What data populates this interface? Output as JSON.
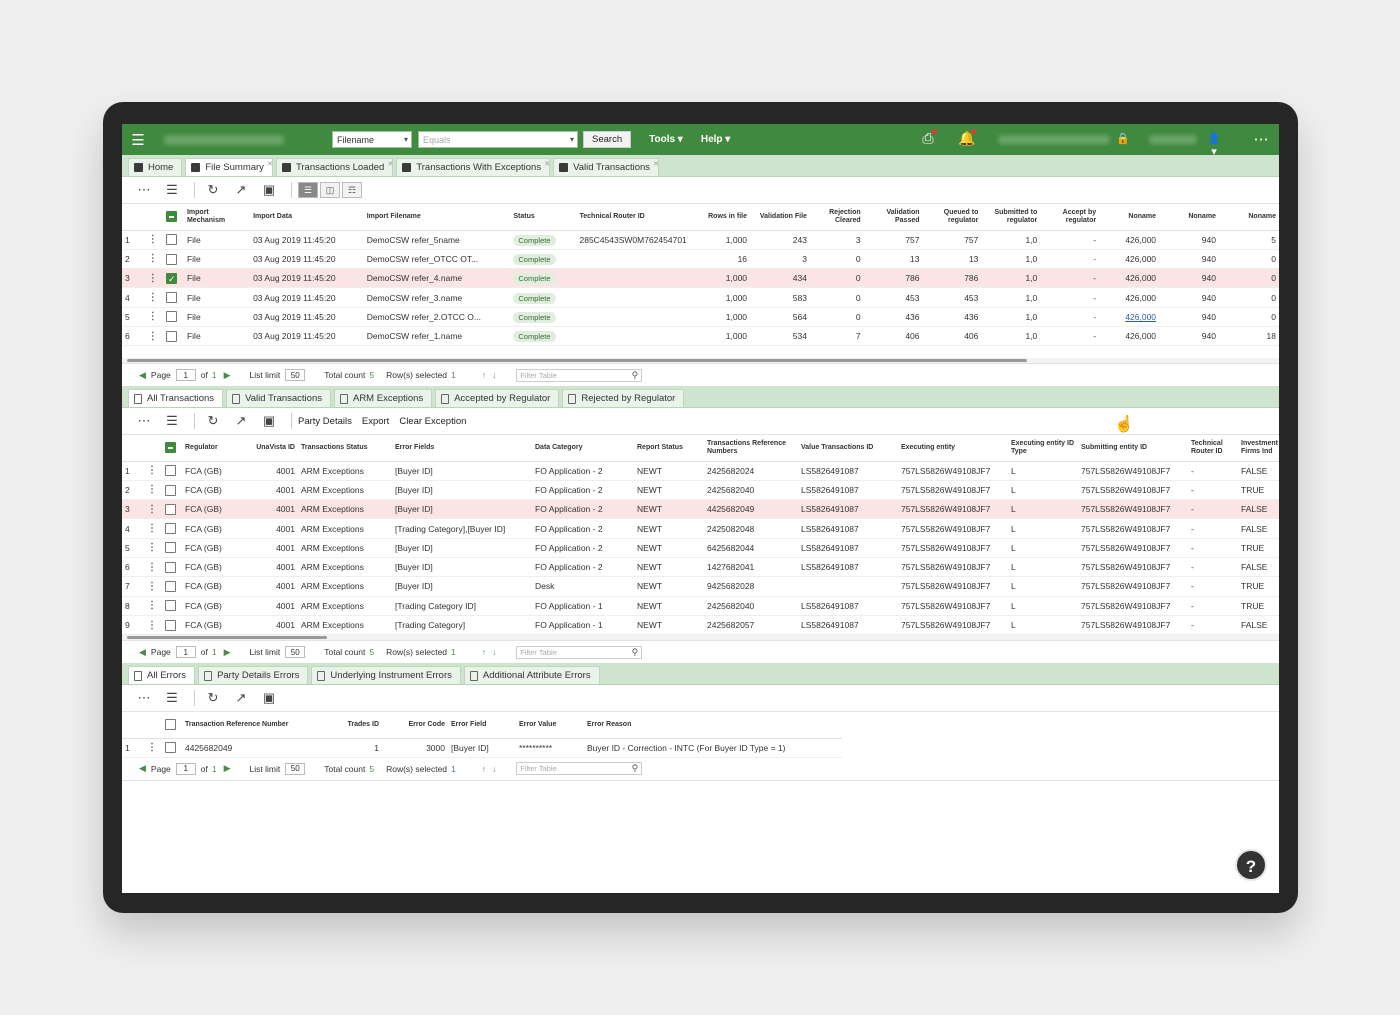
{
  "topbar": {
    "filter_field": "Filename",
    "filter_op_placeholder": "Equals",
    "search_label": "Search",
    "menus": [
      "Tools ▾",
      "Help ▾"
    ],
    "icons": [
      "hamburger-icon",
      "export-notification-icon",
      "bell-icon",
      "lock-icon",
      "user-icon",
      "apps-grid-icon"
    ]
  },
  "main_tabs": [
    {
      "label": "Home"
    },
    {
      "label": "File Summary"
    },
    {
      "label": "Transactions Loaded"
    },
    {
      "label": "Transactions With Exceptions"
    },
    {
      "label": "Valid Transactions"
    }
  ],
  "files": {
    "headers": [
      "Import Mechanism",
      "Import Data",
      "Import Filename",
      "Status",
      "Technical Router ID",
      "Rows in file",
      "Validation File",
      "Rejection Cleared",
      "Validation Passed",
      "Queued to regulator",
      "Submitted to regulator",
      "Accept by regulator",
      "Noname",
      "Noname",
      "Noname"
    ],
    "rows": [
      {
        "n": "1",
        "mech": "File",
        "date": "03 Aug 2019 11:45:20",
        "file": "DemoCSW refer_5name",
        "status": "Complete",
        "router": "285C4543SW0M762454701",
        "rows": "1,000",
        "vf": "243",
        "rc": "3",
        "vp": "757",
        "q": "757",
        "s": "1,0",
        "a": "-",
        "n1": "426,000",
        "n2": "940",
        "n3": "5"
      },
      {
        "n": "2",
        "mech": "File",
        "date": "03 Aug 2019 11:45:20",
        "file": "DemoCSW refer_OTCC OT...",
        "status": "Complete",
        "router": "",
        "rows": "16",
        "vf": "3",
        "rc": "0",
        "vp": "13",
        "q": "13",
        "s": "1,0",
        "a": "-",
        "n1": "426,000",
        "n2": "940",
        "n3": "0"
      },
      {
        "n": "3",
        "mech": "File",
        "date": "03 Aug 2019 11:45:20",
        "file": "DemoCSW refer_4.name",
        "status": "Complete",
        "router": "",
        "rows": "1,000",
        "vf": "434",
        "rc": "0",
        "vp": "786",
        "q": "786",
        "s": "1,0",
        "a": "-",
        "n1": "426,000",
        "n2": "940",
        "n3": "0"
      },
      {
        "n": "4",
        "mech": "File",
        "date": "03 Aug 2019 11:45:20",
        "file": "DemoCSW refer_3.name",
        "status": "Complete",
        "router": "",
        "rows": "1,000",
        "vf": "583",
        "rc": "0",
        "vp": "453",
        "q": "453",
        "s": "1,0",
        "a": "-",
        "n1": "426,000",
        "n2": "940",
        "n3": "0"
      },
      {
        "n": "5",
        "mech": "File",
        "date": "03 Aug 2019 11:45:20",
        "file": "DemoCSW refer_2.OTCC O...",
        "status": "Complete",
        "router": "",
        "rows": "1,000",
        "vf": "564",
        "rc": "0",
        "vp": "436",
        "q": "436",
        "s": "1,0",
        "a": "-",
        "n1": "426,000",
        "n2": "940",
        "n3": "0"
      },
      {
        "n": "6",
        "mech": "File",
        "date": "03 Aug 2019 11:45:20",
        "file": "DemoCSW refer_1.name",
        "status": "Complete",
        "router": "",
        "rows": "1,000",
        "vf": "534",
        "rc": "7",
        "vp": "406",
        "q": "406",
        "s": "1,0",
        "a": "-",
        "n1": "426,000",
        "n2": "940",
        "n3": "18"
      }
    ]
  },
  "pager": {
    "page": "Page",
    "page_num": "1",
    "of": "of",
    "total_pages": "1",
    "list_limit": "List limit",
    "limit": "50",
    "total_count": "Total count",
    "count": "5",
    "rows_selected": "Row(s) selected",
    "selected": "1",
    "filter_placeholder": "Filter Table"
  },
  "tx_tabs": [
    {
      "label": "All Transactions"
    },
    {
      "label": "Valid Transactions"
    },
    {
      "label": "ARM Exceptions"
    },
    {
      "label": "Accepted by Regulator"
    },
    {
      "label": "Rejected by Regulator"
    }
  ],
  "tx_toolbar": {
    "party_details": "Party Details",
    "export": "Export",
    "clear_exception": "Clear Exception"
  },
  "tx": {
    "headers": [
      "Regulator",
      "UnaVista ID",
      "Transactions Status",
      "Error Fields",
      "Data Category",
      "Report Status",
      "Transactions Reference Numbers",
      "Value Transactions ID",
      "Executing entity",
      "Executing entity ID Type",
      "Submitting entity ID",
      "Technical Router ID",
      "Investment Firms Ind"
    ],
    "rows": [
      {
        "n": "1",
        "reg": "FCA (GB)",
        "id": "4001",
        "st": "ARM Exceptions",
        "ef": "[Buyer ID]",
        "dc": "FO Application - 2",
        "rs": "NEWT",
        "ref": "2425682024",
        "vt": "LS5826491087",
        "ee": "757LS5826W49108JF7",
        "et": "L",
        "se": "757LS5826W49108JF7",
        "tr": "-",
        "inv": "FALSE"
      },
      {
        "n": "2",
        "reg": "FCA (GB)",
        "id": "4001",
        "st": "ARM Exceptions",
        "ef": "[Buyer ID]",
        "dc": "FO Application - 2",
        "rs": "NEWT",
        "ref": "2425682040",
        "vt": "LS5826491087",
        "ee": "757LS5826W49108JF7",
        "et": "L",
        "se": "757LS5826W49108JF7",
        "tr": "-",
        "inv": "TRUE"
      },
      {
        "n": "3",
        "reg": "FCA (GB)",
        "id": "4001",
        "st": "ARM Exceptions",
        "ef": "[Buyer ID]",
        "dc": "FO Application - 2",
        "rs": "NEWT",
        "ref": "4425682049",
        "vt": "LS5826491087",
        "ee": "757LS5826W49108JF7",
        "et": "L",
        "se": "757LS5826W49108JF7",
        "tr": "-",
        "inv": "FALSE"
      },
      {
        "n": "4",
        "reg": "FCA (GB)",
        "id": "4001",
        "st": "ARM Exceptions",
        "ef": "[Trading Category],[Buyer ID]",
        "dc": "FO Application - 2",
        "rs": "NEWT",
        "ref": "2425082048",
        "vt": "LS5826491087",
        "ee": "757LS5826W49108JF7",
        "et": "L",
        "se": "757LS5826W49108JF7",
        "tr": "-",
        "inv": "FALSE"
      },
      {
        "n": "5",
        "reg": "FCA (GB)",
        "id": "4001",
        "st": "ARM Exceptions",
        "ef": "[Buyer ID]",
        "dc": "FO Application - 2",
        "rs": "NEWT",
        "ref": "6425682044",
        "vt": "LS5826491087",
        "ee": "757LS5826W49108JF7",
        "et": "L",
        "se": "757LS5826W49108JF7",
        "tr": "-",
        "inv": "TRUE"
      },
      {
        "n": "6",
        "reg": "FCA (GB)",
        "id": "4001",
        "st": "ARM Exceptions",
        "ef": "[Buyer ID]",
        "dc": "FO Application - 2",
        "rs": "NEWT",
        "ref": "1427682041",
        "vt": "LS5826491087",
        "ee": "757LS5826W49108JF7",
        "et": "L",
        "se": "757LS5826W49108JF7",
        "tr": "-",
        "inv": "FALSE"
      },
      {
        "n": "7",
        "reg": "FCA (GB)",
        "id": "4001",
        "st": "ARM Exceptions",
        "ef": "[Buyer ID]",
        "dc": "Desk",
        "rs": "NEWT",
        "ref": "9425682028",
        "vt": "",
        "ee": "757LS5826W49108JF7",
        "et": "L",
        "se": "757LS5826W49108JF7",
        "tr": "-",
        "inv": "TRUE"
      },
      {
        "n": "8",
        "reg": "FCA (GB)",
        "id": "4001",
        "st": "ARM Exceptions",
        "ef": "[Trading Category ID]",
        "dc": "FO Application - 1",
        "rs": "NEWT",
        "ref": "2425682040",
        "vt": "LS5826491087",
        "ee": "757LS5826W49108JF7",
        "et": "L",
        "se": "757LS5826W49108JF7",
        "tr": "-",
        "inv": "TRUE"
      },
      {
        "n": "9",
        "reg": "FCA (GB)",
        "id": "4001",
        "st": "ARM Exceptions",
        "ef": "[Trading Category]",
        "dc": "FO Application - 1",
        "rs": "NEWT",
        "ref": "2425682057",
        "vt": "LS5826491087",
        "ee": "757LS5826W49108JF7",
        "et": "L",
        "se": "757LS5826W49108JF7",
        "tr": "-",
        "inv": "FALSE"
      }
    ]
  },
  "err_tabs": [
    {
      "label": "All Errors"
    },
    {
      "label": "Party Details Errors"
    },
    {
      "label": "Underlying Instrument Errors"
    },
    {
      "label": "Additional Attribute Errors"
    }
  ],
  "errors": {
    "headers": [
      "Transaction Reference Number",
      "Trades ID",
      "Error Code",
      "Error Field",
      "Error Value",
      "Error Reason"
    ],
    "rows": [
      {
        "n": "1",
        "ref": "4425682049",
        "tid": "1",
        "code": "3000",
        "field": "[Buyer ID]",
        "value": "**********",
        "reason": "Buyer ID - Correction - INTC (For Buyer ID Type = 1)"
      }
    ]
  },
  "help_label": "?",
  "colors": {
    "brand": "#3f8a3f",
    "tab_bar": "#cfe4cf",
    "highlight_row": "#fbe4e4"
  }
}
